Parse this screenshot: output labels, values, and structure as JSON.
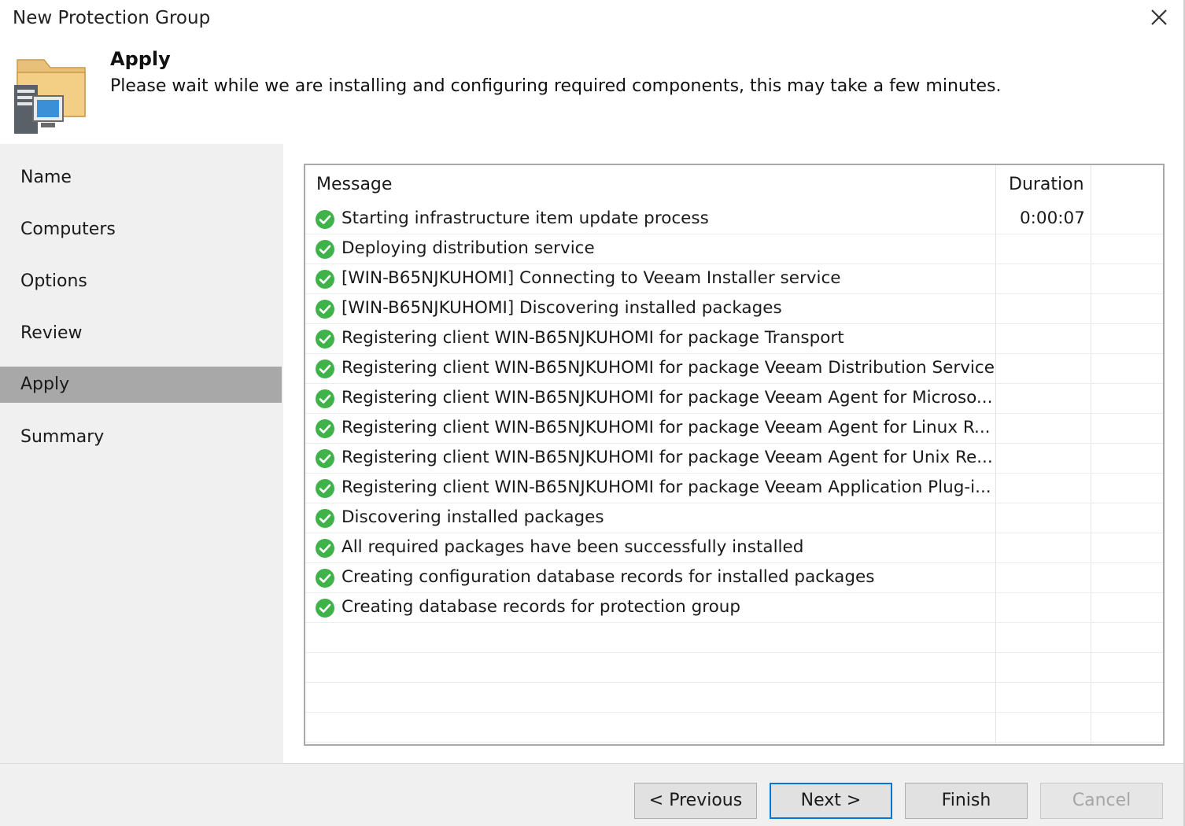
{
  "window": {
    "title": "New Protection Group",
    "close_icon": "close-icon"
  },
  "header": {
    "icon": "protection-group-icon",
    "step_title": "Apply",
    "step_description": "Please wait while we are installing and configuring required components, this may take a few minutes."
  },
  "nav": {
    "items": [
      {
        "label": "Name",
        "active": false
      },
      {
        "label": "Computers",
        "active": false
      },
      {
        "label": "Options",
        "active": false
      },
      {
        "label": "Review",
        "active": false
      },
      {
        "label": "Apply",
        "active": true
      },
      {
        "label": "Summary",
        "active": false
      }
    ]
  },
  "log": {
    "columns": {
      "message": "Message",
      "duration": "Duration"
    },
    "status_icon": "success-check-icon",
    "rows": [
      {
        "message": "Starting infrastructure item update process",
        "duration": "0:00:07"
      },
      {
        "message": "Deploying distribution service",
        "duration": ""
      },
      {
        "message": "[WIN-B65NJKUHOMI] Connecting to Veeam Installer service",
        "duration": ""
      },
      {
        "message": "[WIN-B65NJKUHOMI] Discovering installed packages",
        "duration": ""
      },
      {
        "message": "Registering client WIN-B65NJKUHOMI for package Transport",
        "duration": ""
      },
      {
        "message": "Registering client WIN-B65NJKUHOMI for package Veeam Distribution Service",
        "duration": ""
      },
      {
        "message": "Registering client WIN-B65NJKUHOMI for package Veeam Agent for Microso...",
        "duration": ""
      },
      {
        "message": "Registering client WIN-B65NJKUHOMI for package Veeam Agent for Linux R...",
        "duration": ""
      },
      {
        "message": "Registering client WIN-B65NJKUHOMI for package Veeam Agent for Unix Re...",
        "duration": ""
      },
      {
        "message": "Registering client WIN-B65NJKUHOMI for package Veeam Application Plug-i...",
        "duration": ""
      },
      {
        "message": "Discovering installed packages",
        "duration": ""
      },
      {
        "message": "All required packages have been successfully installed",
        "duration": ""
      },
      {
        "message": "Creating configuration database records for installed packages",
        "duration": ""
      },
      {
        "message": "Creating database records for protection group",
        "duration": ""
      }
    ]
  },
  "footer": {
    "previous_label": "< Previous",
    "next_label": "Next >",
    "finish_label": "Finish",
    "cancel_label": "Cancel",
    "cancel_disabled": true
  },
  "colors": {
    "success_green": "#3fb24a",
    "active_nav": "#a8a8a8",
    "primary_border": "#0078d7"
  }
}
